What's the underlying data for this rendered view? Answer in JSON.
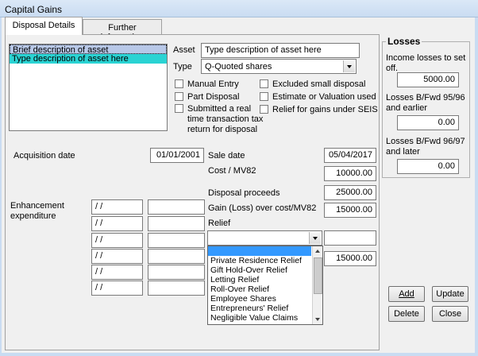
{
  "window": {
    "title": "Capital Gains"
  },
  "tabs": [
    {
      "label": "Disposal Details",
      "active": true
    },
    {
      "label": "Further information",
      "active": false
    }
  ],
  "asset_list": [
    {
      "label": "Brief description of asset",
      "selected": true
    },
    {
      "label": "Type description of asset here",
      "selected": true
    }
  ],
  "asset": {
    "label": "Asset",
    "value": "Type description of asset here",
    "type_label": "Type",
    "type_value": "Q-Quoted shares"
  },
  "checkboxes": {
    "manual_entry": {
      "label": "Manual Entry",
      "checked": false
    },
    "part_disposal": {
      "label": "Part Disposal",
      "checked": false
    },
    "rtt_return": {
      "label_lines": [
        "Submitted a real",
        "time transaction tax",
        "return for disposal"
      ],
      "checked": false
    },
    "excluded_small": {
      "label": "Excluded small disposal",
      "checked": false
    },
    "estimate": {
      "label": "Estimate or Valuation used",
      "checked": false
    },
    "seis_relief": {
      "label": "Relief for gains under SEIS",
      "checked": false
    }
  },
  "acquisition": {
    "label": "Acquisition date",
    "value": "01/01/2001"
  },
  "sale": {
    "label": "Sale date",
    "value": "05/04/2017",
    "cost_label": "Cost / MV82",
    "cost_value": "10000.00",
    "proceeds_label": "Disposal proceeds",
    "proceeds_value": "25000.00",
    "gain_label": "Gain (Loss) over cost/MV82",
    "gain_value": "15000.00"
  },
  "relief": {
    "label": "Relief",
    "selected": "",
    "amount": "",
    "result": "15000.00",
    "options": [
      "",
      "Private Residence Relief",
      "Gift Hold-Over Relief",
      "Letting Relief",
      "Roll-Over Relief",
      "Employee Shares",
      "Entrepreneurs' Relief",
      "Negligible Value Claims"
    ],
    "highlighted_index": 0
  },
  "enhancement": {
    "label_lines": [
      "Enhancement",
      "expenditure"
    ],
    "rows": [
      {
        "date": " / /",
        "amount": ""
      },
      {
        "date": " / /",
        "amount": ""
      },
      {
        "date": " / /",
        "amount": ""
      },
      {
        "date": " / /",
        "amount": ""
      },
      {
        "date": " / /",
        "amount": ""
      },
      {
        "date": " / /",
        "amount": ""
      }
    ]
  },
  "losses": {
    "title": "Losses",
    "income_label_lines": [
      "Income losses to set",
      "off."
    ],
    "income_value": "5000.00",
    "bfwd_9596_label_lines": [
      "Losses B/Fwd 95/96",
      "and earlier"
    ],
    "bfwd_9596_value": "0.00",
    "bfwd_9697_label_lines": [
      "Losses B/Fwd 96/97",
      "and later"
    ],
    "bfwd_9697_value": "0.00"
  },
  "buttons": {
    "add": "Add",
    "update": "Update",
    "delete": "Delete",
    "close": "Close"
  },
  "colors": {
    "selection_cyan": "#2ad3d3",
    "selection_blue": "#b8c8e8",
    "dropdown_highlight": "#3399ff"
  }
}
